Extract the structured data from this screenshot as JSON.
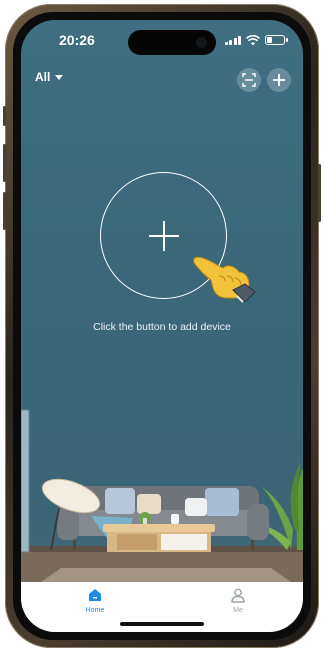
{
  "status_bar": {
    "time": "20:26",
    "battery_level": 0.35
  },
  "top_bar": {
    "filter_label": "All",
    "scan_icon": "scan-icon",
    "add_icon": "plus-icon"
  },
  "empty_state": {
    "hint": "Click the button to add device"
  },
  "tabs": [
    {
      "label": "Home",
      "icon": "home-icon",
      "active": true,
      "color": "#1e8be8"
    },
    {
      "label": "Me",
      "icon": "person-icon",
      "active": false,
      "color": "#9aa4ab"
    }
  ],
  "colors": {
    "accent": "#1e8be8",
    "background": "#3e6e80"
  }
}
